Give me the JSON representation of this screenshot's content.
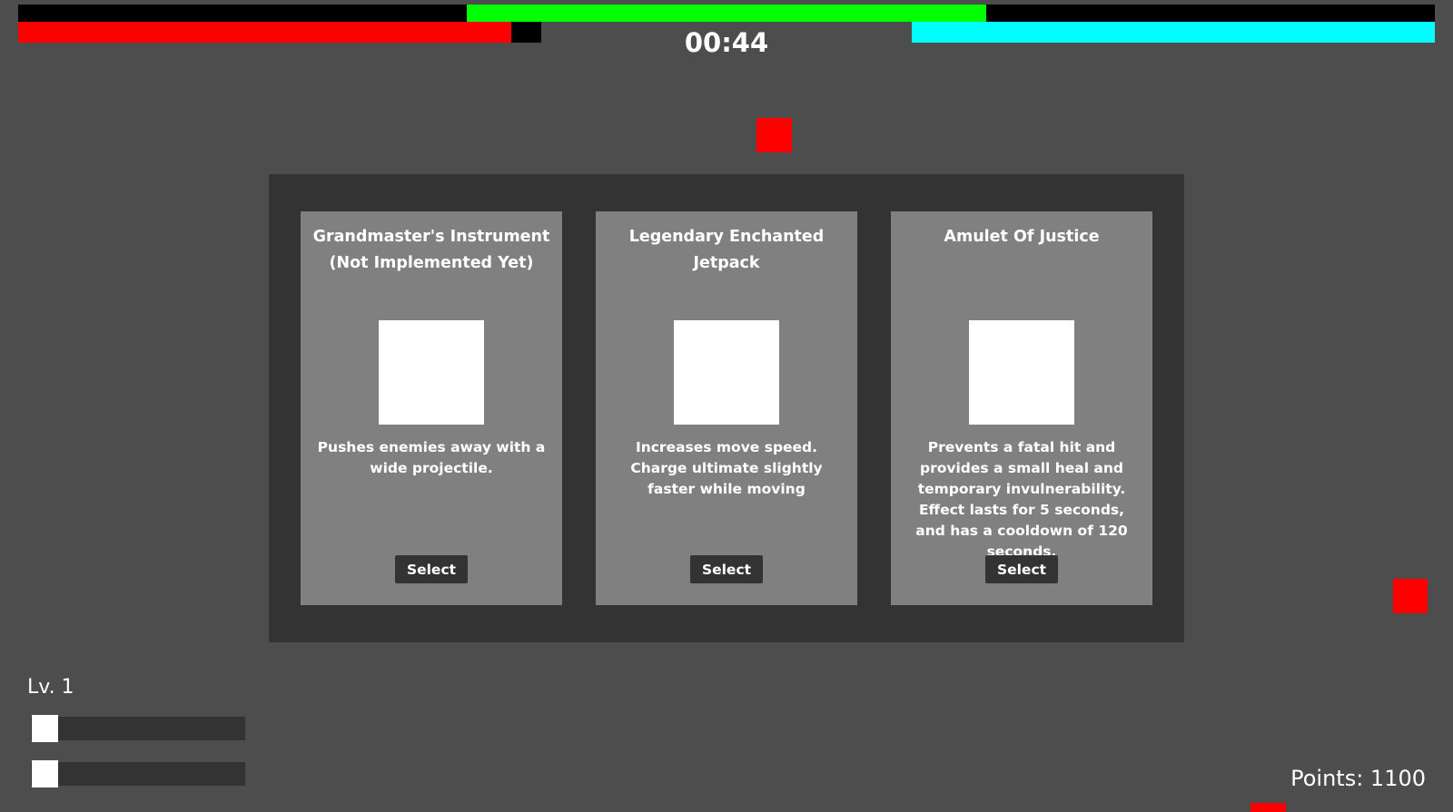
{
  "hud": {
    "timer": "00:44",
    "boss_bar": {
      "color": "#00ff00",
      "fill_fraction": 0.367,
      "offset_fraction": 0.316
    },
    "player_health": {
      "color": "#ff0000",
      "fill_fraction": 0.943
    },
    "shield_bar": {
      "color": "#00ffff",
      "fill_fraction": 1.0
    }
  },
  "upgrade_dialog": {
    "cards": [
      {
        "title": "Grandmaster's Instrument (Not Implemented Yet)",
        "description": "Pushes enemies away with a wide projectile.",
        "button_label": "Select"
      },
      {
        "title": "Legendary Enchanted Jetpack",
        "description": "Increases move speed. Charge ultimate slightly faster while moving",
        "button_label": "Select"
      },
      {
        "title": "Amulet Of Justice",
        "description": "Prevents a fatal hit and provides a small heal and temporary invulnerability. Effect lasts for 5 seconds, and has a cooldown of 120 seconds.",
        "button_label": "Select"
      }
    ]
  },
  "player": {
    "level_label": "Lv. 1",
    "xp_bar": {
      "fill_fraction": 0.0
    },
    "ultimate_bar": {
      "fill_fraction": 0.0
    }
  },
  "score": {
    "points_label": "Points: 1100"
  },
  "colors": {
    "background": "#4d4d4d",
    "enemy": "#ff0000",
    "enemy_dark": "#a80000",
    "panel": "#333333",
    "card": "#808080"
  }
}
